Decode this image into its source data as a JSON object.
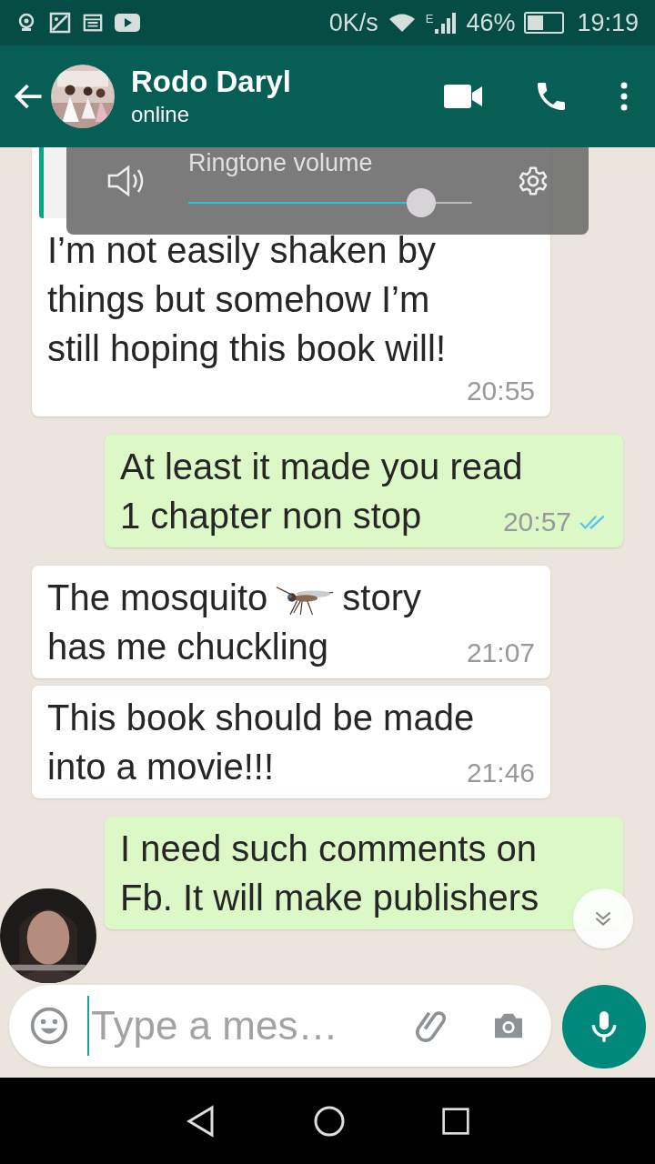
{
  "status_bar": {
    "speed": "0K/s",
    "network_type": "E",
    "battery": "46%",
    "time": "19:19"
  },
  "header": {
    "name": "Rodo Daryl",
    "status": "online"
  },
  "volume_panel": {
    "title": "Ringtone volume",
    "level": 0.82
  },
  "messages": [
    {
      "kind": "incoming",
      "quoted": true,
      "lines": [
        {
          "segments": [
            {
              "kind": "text",
              "text": "I’m not easily shaken by"
            }
          ]
        },
        {
          "segments": [
            {
              "kind": "text",
              "text": "things but somehow I’m"
            }
          ]
        },
        {
          "segments": [
            {
              "kind": "text",
              "text": "still hoping this book will!"
            }
          ]
        }
      ],
      "time": "20:55"
    },
    {
      "kind": "outgoing",
      "lines": [
        {
          "segments": [
            {
              "kind": "text",
              "text": "At least it made you read"
            }
          ]
        },
        {
          "segments": [
            {
              "kind": "text",
              "text": "1 chapter non stop"
            }
          ]
        }
      ],
      "time": "20:57",
      "read": true
    },
    {
      "kind": "incoming",
      "lines": [
        {
          "segments": [
            {
              "kind": "text",
              "text": "The mosquito"
            },
            {
              "kind": "emoji"
            },
            {
              "kind": "text",
              "text": "story"
            }
          ]
        },
        {
          "segments": [
            {
              "kind": "text",
              "text": "has me chuckling"
            }
          ]
        }
      ],
      "time": "21:07"
    },
    {
      "kind": "incoming",
      "lines": [
        {
          "segments": [
            {
              "kind": "text",
              "text": "This book should be made"
            }
          ]
        },
        {
          "segments": [
            {
              "kind": "text",
              "text": "into a movie!!!"
            }
          ]
        }
      ],
      "time": "21:46"
    },
    {
      "kind": "outgoing",
      "lines": [
        {
          "segments": [
            {
              "kind": "text",
              "text": "I need such comments on"
            }
          ]
        },
        {
          "segments": [
            {
              "kind": "text",
              "text": "Fb. It will make publishers"
            }
          ]
        }
      ]
    }
  ],
  "composer": {
    "placeholder": "Type a mes…"
  }
}
